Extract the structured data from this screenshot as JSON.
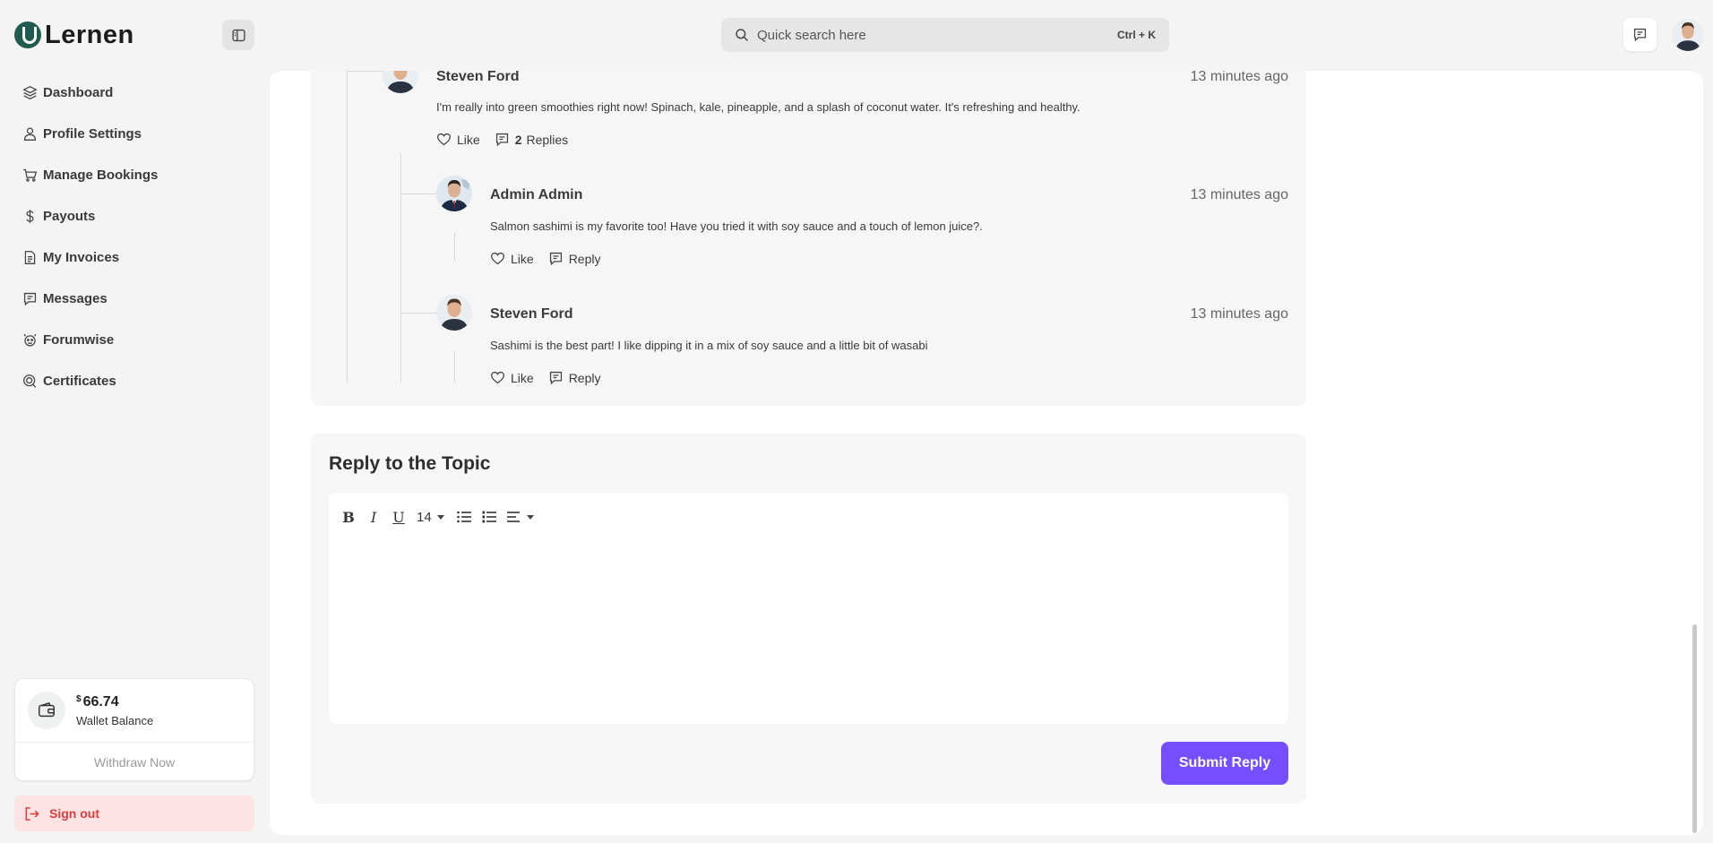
{
  "app": {
    "name": "Lernen"
  },
  "sidebar": {
    "items": [
      {
        "label": "Dashboard",
        "icon": "layers-icon"
      },
      {
        "label": "Profile Settings",
        "icon": "user-icon"
      },
      {
        "label": "Manage Bookings",
        "icon": "cart-icon"
      },
      {
        "label": "Payouts",
        "icon": "dollar-icon"
      },
      {
        "label": "My Invoices",
        "icon": "invoice-icon"
      },
      {
        "label": "Messages",
        "icon": "message-icon"
      },
      {
        "label": "Forumwise",
        "icon": "forum-icon"
      },
      {
        "label": "Certificates",
        "icon": "certificate-icon"
      }
    ],
    "wallet": {
      "currency": "$",
      "amount": "66.74",
      "label": "Wallet Balance",
      "withdraw_label": "Withdraw Now"
    },
    "signout_label": "Sign out"
  },
  "header": {
    "search": {
      "placeholder": "Quick search here",
      "shortcut": "Ctrl + K"
    }
  },
  "thread": {
    "comments": [
      {
        "author": "Steven Ford",
        "time": "13 minutes ago",
        "text": "I'm really into green smoothies right now! Spinach, kale, pineapple, and a splash of coconut water. It's refreshing and healthy.",
        "like_label": "Like",
        "replies_count": "2",
        "replies_label": "Replies"
      },
      {
        "author": "Admin Admin",
        "time": "13 minutes ago",
        "text": "Salmon sashimi is my favorite too! Have you tried it with soy sauce and a touch of lemon juice?.",
        "like_label": "Like",
        "reply_label": "Reply"
      },
      {
        "author": "Steven Ford",
        "time": "13 minutes ago",
        "text": "Sashimi is the best part! I like dipping it in a mix of soy sauce and a little bit of wasabi",
        "like_label": "Like",
        "reply_label": "Reply"
      }
    ]
  },
  "reply": {
    "title": "Reply to the Topic",
    "font_size": "14",
    "submit_label": "Submit Reply"
  },
  "colors": {
    "accent": "#754ffe",
    "brand": "#1f5c4f",
    "danger": "#e03b3b"
  }
}
